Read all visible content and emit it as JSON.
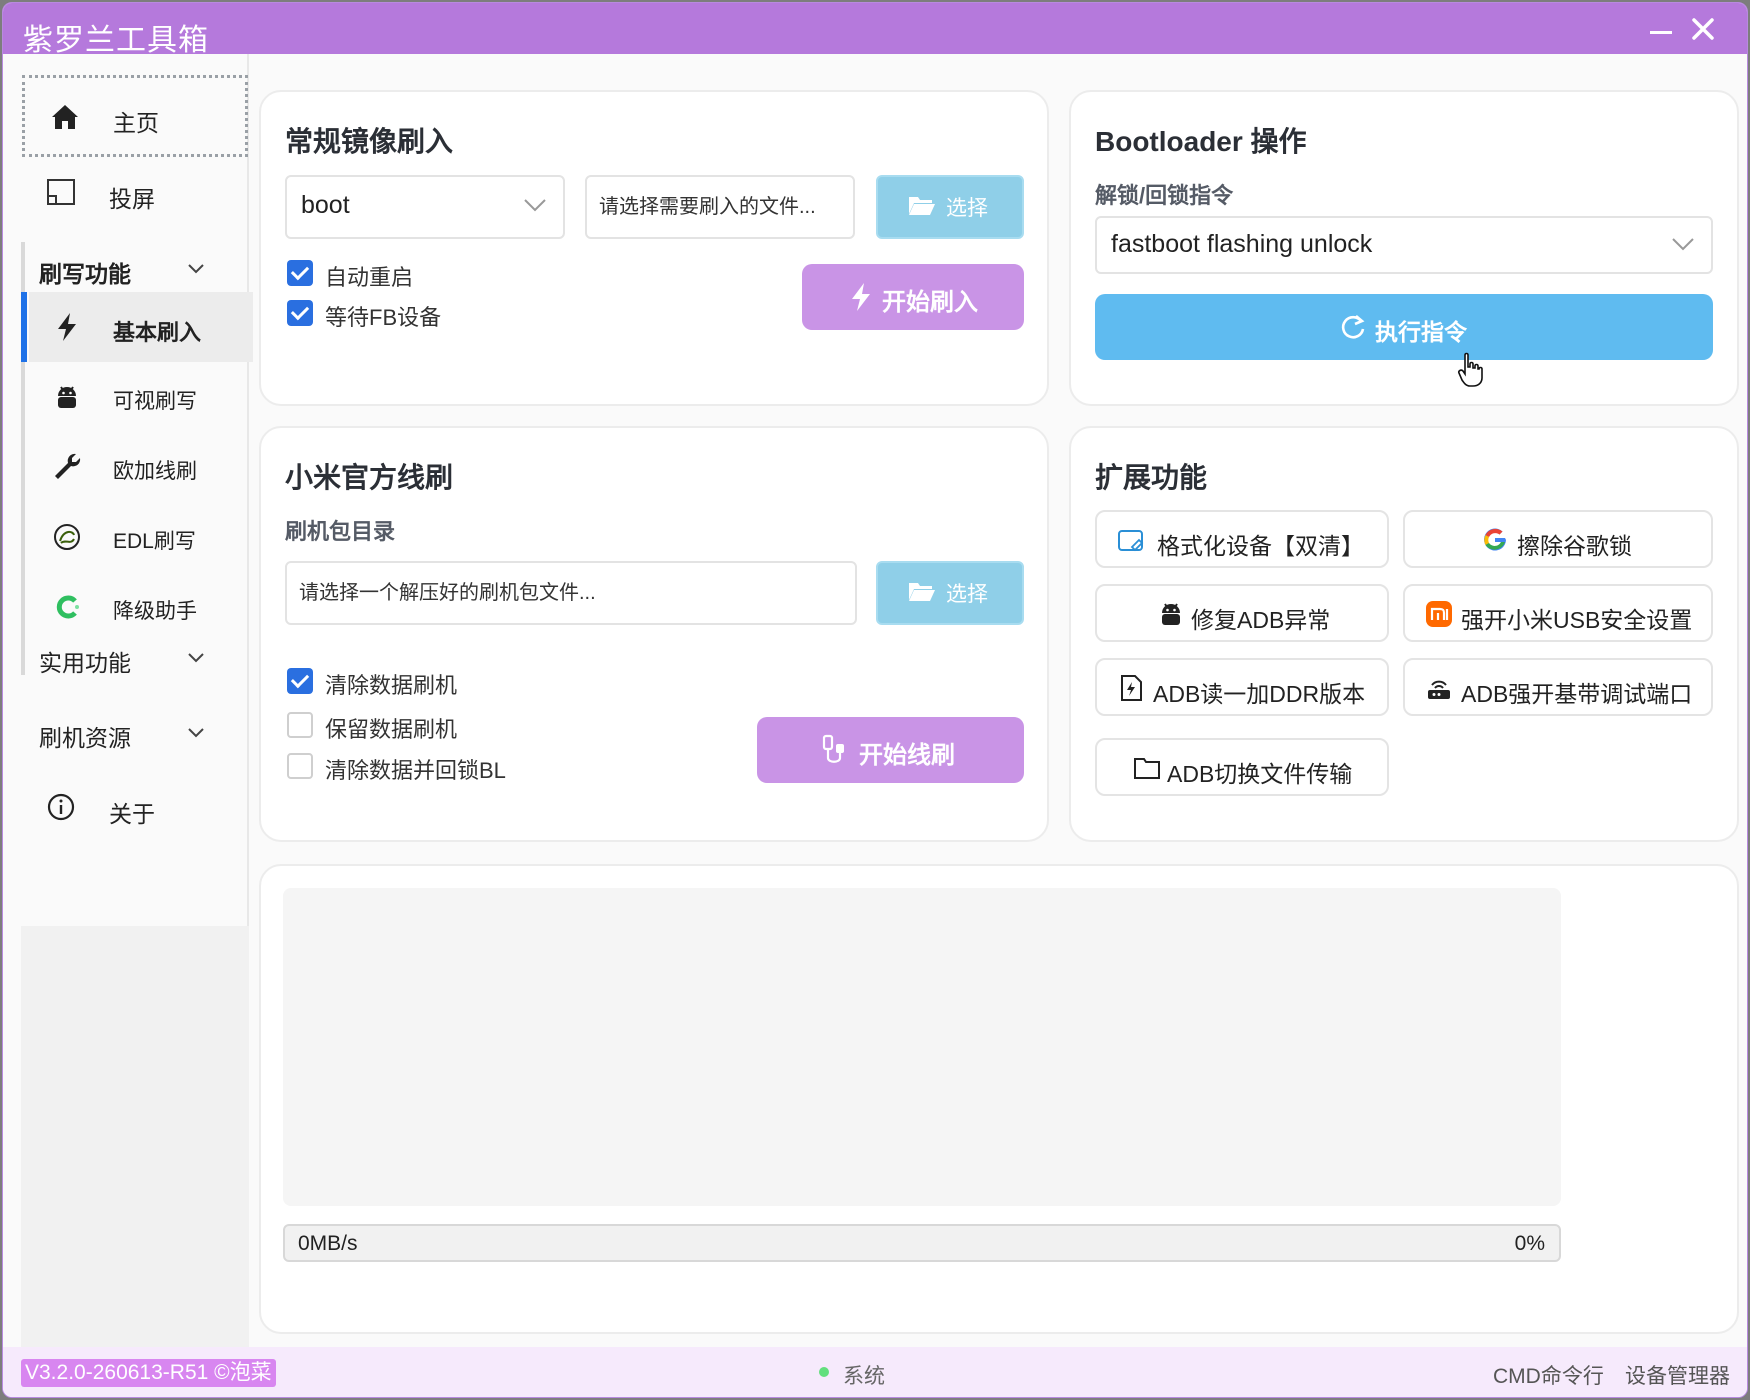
{
  "app": {
    "title": "紫罗兰工具箱"
  },
  "sidebar": {
    "home": "主页",
    "cast": "投屏",
    "group_flash": "刷写功能",
    "sub": {
      "basic": "基本刷入",
      "visual": "可视刷写",
      "oneplus": "欧加线刷",
      "edl": "EDL刷写",
      "downgrade": "降级助手"
    },
    "group_util": "实用功能",
    "group_res": "刷机资源",
    "about": "关于"
  },
  "flash_card": {
    "title": "常规镜像刷入",
    "partition": "boot",
    "file_placeholder": "请选择需要刷入的文件...",
    "select_label": "选择",
    "auto_reboot": "自动重启",
    "auto_reboot_checked": true,
    "wait_fb": "等待FB设备",
    "wait_fb_checked": true,
    "start_label": "开始刷入"
  },
  "bootloader_card": {
    "title": "Bootloader 操作",
    "cmd_label": "解锁/回锁指令",
    "cmd_value": "fastboot flashing unlock",
    "exec_label": "执行指令"
  },
  "mi_card": {
    "title": "小米官方线刷",
    "dir_label": "刷机包目录",
    "dir_placeholder": "请选择一个解压好的刷机包文件...",
    "select_label": "选择",
    "opt_clean": "清除数据刷机",
    "opt_clean_checked": true,
    "opt_keep": "保留数据刷机",
    "opt_keep_checked": false,
    "opt_lock": "清除数据并回锁BL",
    "opt_lock_checked": false,
    "start_label": "开始线刷"
  },
  "ext_card": {
    "title": "扩展功能",
    "btn_format": "格式化设备【双清】",
    "btn_google": "擦除谷歌锁",
    "btn_fixadb": "修复ADB异常",
    "btn_miusb": "强开小米USB安全设置",
    "btn_ddr": "ADB读一加DDR版本",
    "btn_port": "ADB强开基带调试端口",
    "btn_transfer": "ADB切换文件传输"
  },
  "log": {
    "text": ""
  },
  "progress": {
    "speed": "0MB/s",
    "percent_text": "0%",
    "value": 0
  },
  "status": {
    "version": "V3.2.0-260613-R51 ©泡菜",
    "system": "系统",
    "cmd": "CMD命令行",
    "devmgr": "设备管理器"
  },
  "colors": {
    "titlebar": "#b579dc",
    "accent_purple": "#c994e6",
    "accent_blue": "#5fbbf0",
    "check_blue": "#2a6fe0"
  }
}
